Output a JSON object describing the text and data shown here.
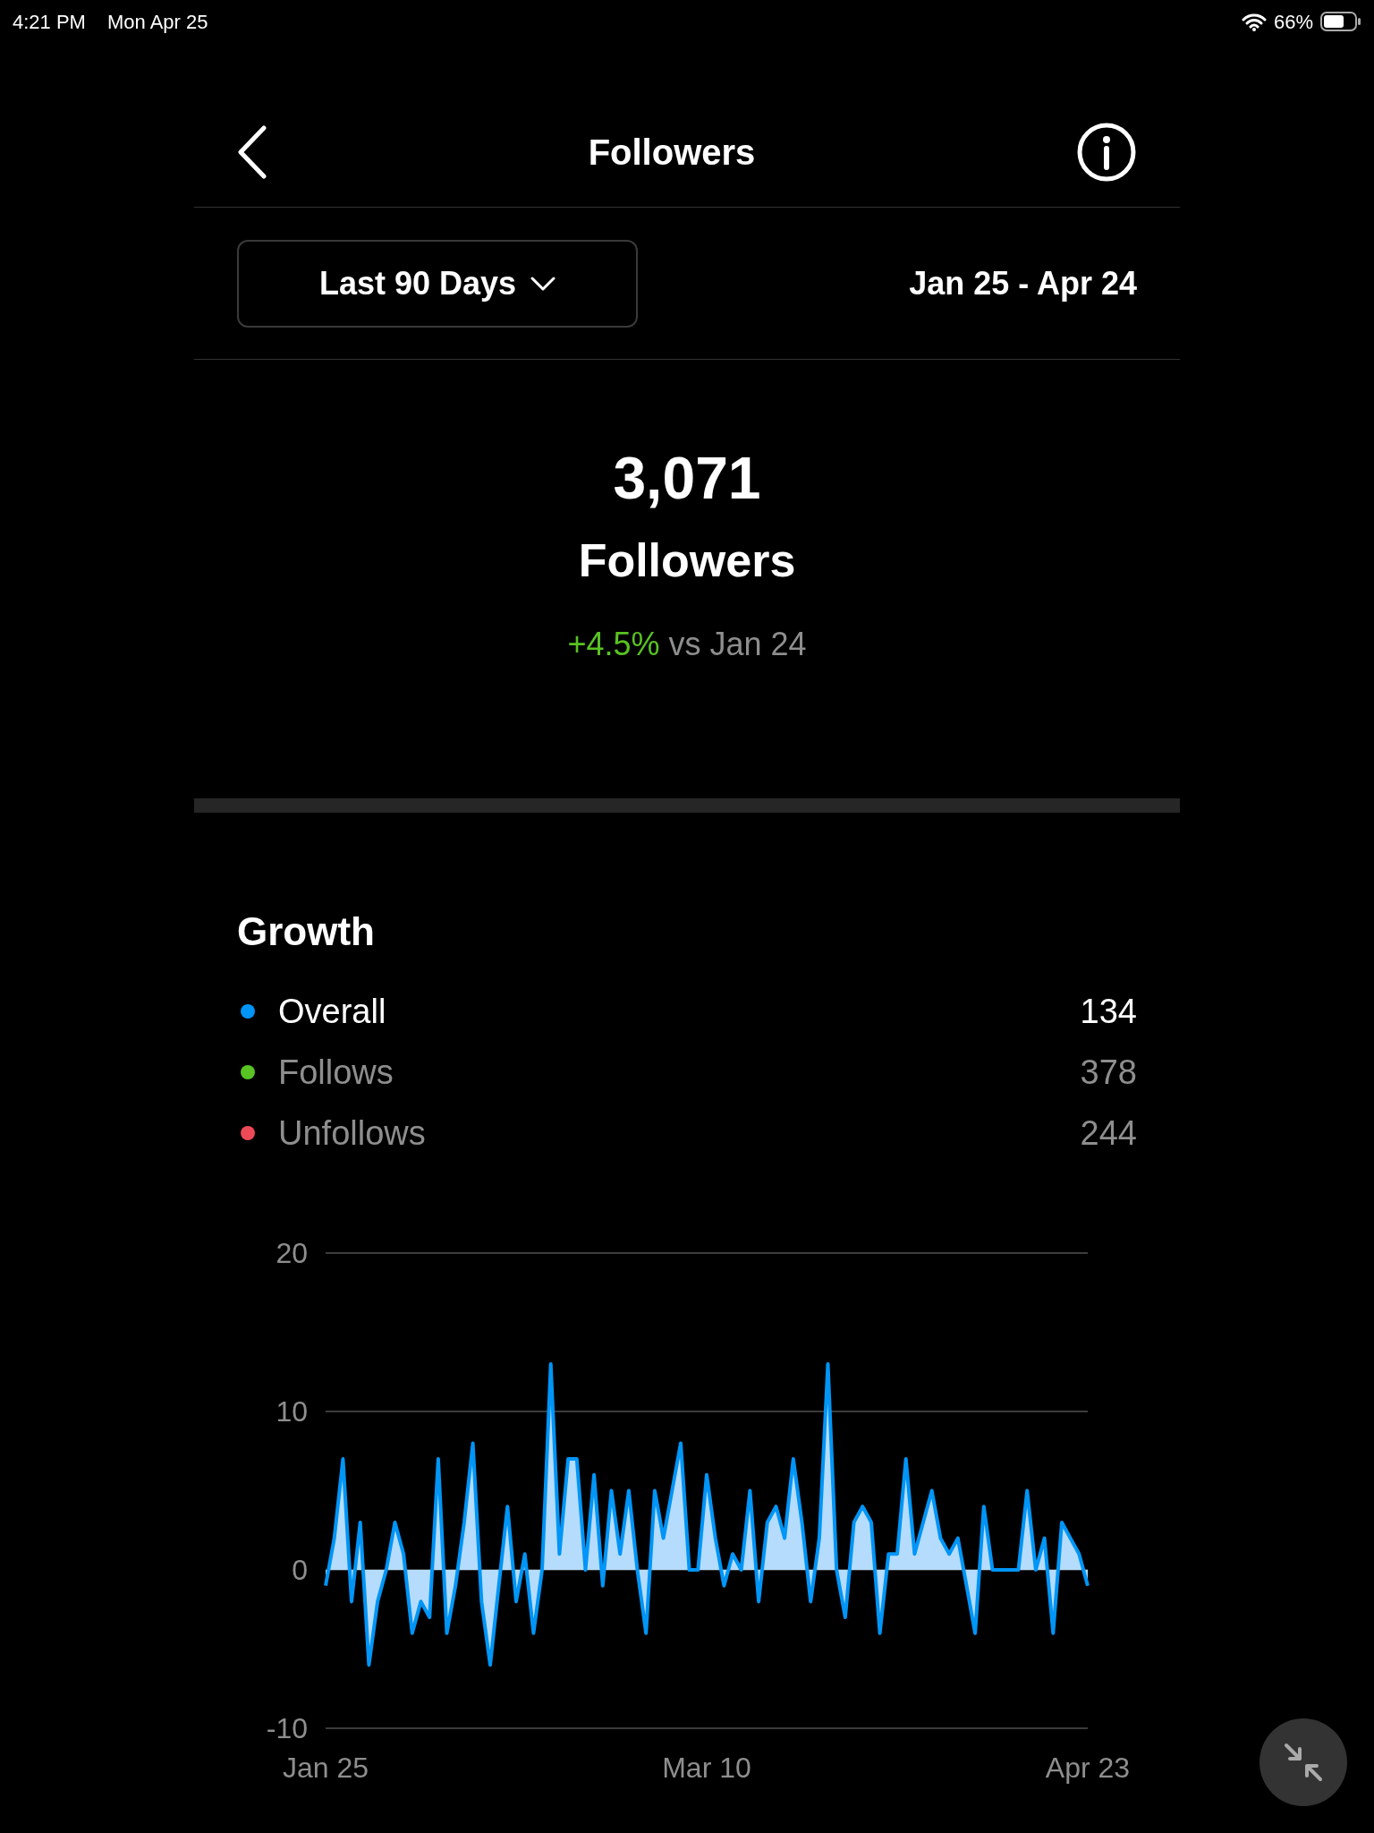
{
  "status_bar": {
    "time": "4:21 PM",
    "date": "Mon Apr 25",
    "battery": "66%"
  },
  "header": {
    "title": "Followers"
  },
  "filter": {
    "period": "Last 90 Days",
    "range": "Jan 25 - Apr 24"
  },
  "summary": {
    "count": "3,071",
    "label": "Followers",
    "change": "+4.5%",
    "comparison": "vs Jan 24"
  },
  "growth": {
    "title": "Growth",
    "legend": [
      {
        "label": "Overall",
        "value": "134",
        "color": "#0095f6",
        "selected": true
      },
      {
        "label": "Follows",
        "value": "378",
        "color": "#58c322",
        "selected": false
      },
      {
        "label": "Unfollows",
        "value": "244",
        "color": "#ed4956",
        "selected": false
      }
    ],
    "chart_data": {
      "type": "area",
      "categories": [
        "Jan 25",
        null,
        null,
        null,
        null,
        null,
        null,
        null,
        null,
        null,
        null,
        null,
        null,
        null,
        null,
        null,
        null,
        null,
        null,
        null,
        null,
        null,
        null,
        null,
        null,
        null,
        null,
        null,
        null,
        null,
        null,
        null,
        null,
        null,
        null,
        null,
        null,
        null,
        null,
        null,
        null,
        null,
        null,
        null,
        "Mar 10",
        null,
        null,
        null,
        null,
        null,
        null,
        null,
        null,
        null,
        null,
        null,
        null,
        null,
        null,
        null,
        null,
        null,
        null,
        null,
        null,
        null,
        null,
        null,
        null,
        null,
        null,
        null,
        null,
        null,
        null,
        null,
        null,
        null,
        null,
        null,
        null,
        null,
        null,
        null,
        null,
        null,
        null,
        null,
        "Apr 23"
      ],
      "series": [
        {
          "color": "#0095f6",
          "values": [
            -1,
            2,
            7,
            -2,
            3,
            -6,
            -2,
            0,
            3,
            1,
            -4,
            -2,
            -3,
            7,
            -4,
            -1,
            3,
            8,
            -2,
            -6,
            -1,
            4,
            -2,
            1,
            -4,
            0,
            13,
            1,
            7,
            7,
            0,
            6,
            -1,
            5,
            1,
            5,
            0,
            -4,
            5,
            2,
            5,
            8,
            0,
            0,
            6,
            2,
            -1,
            1,
            0,
            5,
            -2,
            3,
            4,
            2,
            7,
            3,
            -2,
            2,
            13,
            0,
            -3,
            3,
            4,
            3,
            -4,
            1,
            1,
            7,
            1,
            3,
            5,
            2,
            1,
            2,
            -1,
            -4,
            4,
            0,
            0,
            0,
            0,
            5,
            0,
            2,
            -4,
            3,
            2,
            1,
            -1
          ]
        }
      ],
      "ylim": [
        -10,
        20
      ],
      "yticks": [
        -10,
        0,
        10,
        20
      ]
    }
  }
}
